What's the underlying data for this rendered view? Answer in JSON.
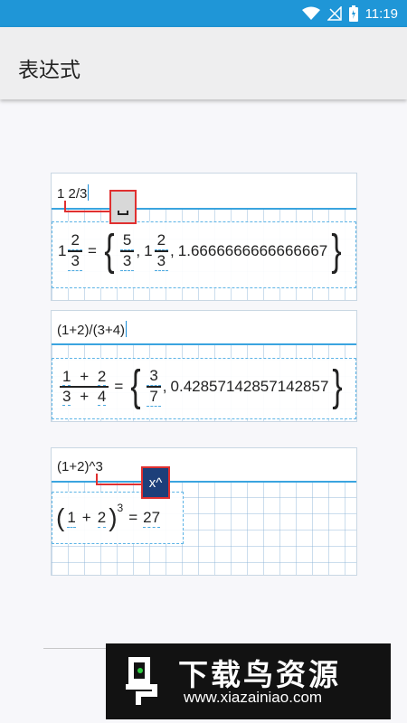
{
  "status_bar": {
    "time": "11:19",
    "icons": [
      "wifi-icon",
      "no-signal-icon",
      "battery-icon"
    ]
  },
  "app_bar": {
    "title": "表达式"
  },
  "expressions": [
    {
      "input": "1 2/3",
      "result": {
        "whole": "1",
        "num": "2",
        "den": "3",
        "eq": "=",
        "alt1_num": "5",
        "alt1_den": "3",
        "alt2_whole": "1",
        "alt2_num": "2",
        "alt2_den": "3",
        "decimal": "1.6666666666666667",
        "sep": ","
      },
      "callout_key": "space-key"
    },
    {
      "input": "(1+2)/(3+4)",
      "result": {
        "num_a": "1",
        "plus1": "+",
        "num_b": "2",
        "den_a": "3",
        "plus2": "+",
        "den_b": "4",
        "eq": "=",
        "alt_num": "3",
        "alt_den": "7",
        "decimal": "0.42857142857142857",
        "sep": ","
      }
    },
    {
      "input": "(1+2)^3",
      "result": {
        "lparen": "(",
        "a": "1",
        "plus": "+",
        "b": "2",
        "rparen": ")",
        "exp": "3",
        "eq": "=",
        "value": "27"
      },
      "callout_key": "power-key",
      "callout_label": "x^"
    }
  ],
  "watermark": {
    "title": "下载鸟资源",
    "url": "www.xiazainiao.com"
  }
}
